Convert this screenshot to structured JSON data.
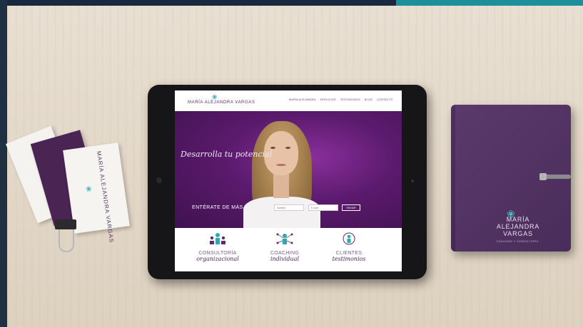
{
  "scene": {
    "desk_color": "#e5dbcc",
    "accent_teal": "#1c8f9a",
    "brand_purple": "#5a1a6c"
  },
  "website": {
    "logo_icon": "lotus-icon",
    "logo_text": "MARÍA ALEJANDRA VARGAS",
    "nav": [
      "MARÍA ALEJANDRA",
      "SERVICIOS",
      "TESTIMONIOS",
      "BLOG",
      "CONTACTO"
    ],
    "hero": {
      "tagline": "Desarrolla tu potencial",
      "cta_label": "ENTÉRATE DE MÁS",
      "name_placeholder": "Nombre",
      "email_placeholder": "E-mail",
      "send_label": "ENVIAR"
    },
    "services": [
      {
        "icon": "group-icon",
        "line1": "CONSULTORÍA",
        "line2": "organizacional"
      },
      {
        "icon": "network-person-icon",
        "line1": "COACHING",
        "line2": "individual"
      },
      {
        "icon": "person-circle-icon",
        "line1": "CLIENTES",
        "line2": "testimonios"
      }
    ]
  },
  "business_card": {
    "text": "MARÍA ALEJANDRA VARGAS"
  },
  "notebook": {
    "name_line1": "MARÍA",
    "name_line2": "ALEJANDRA",
    "name_line3": "VARGAS",
    "subtitle": "COACHING Y CONSULTORÍA"
  }
}
